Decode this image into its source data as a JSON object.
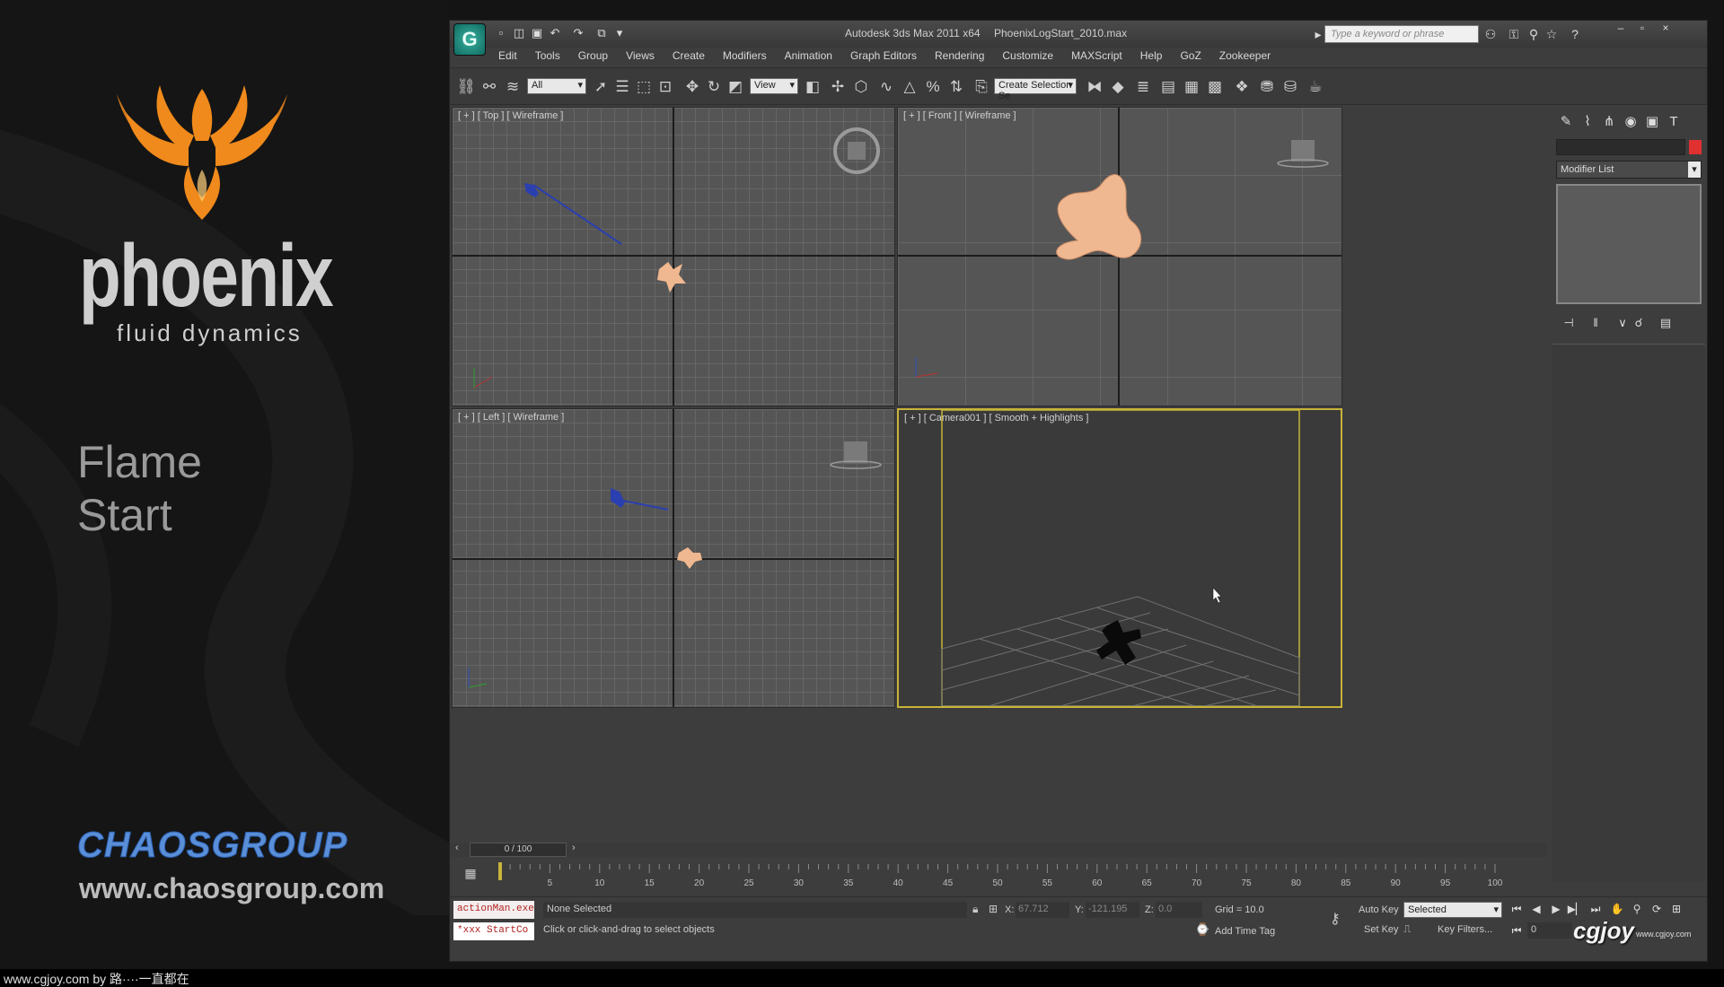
{
  "promo": {
    "brand": "phoenix",
    "tagline": "fluid dynamics",
    "lesson_line1": "Flame",
    "lesson_line2": "Start",
    "company": "CHAOSGROUP",
    "company_url": "www.chaosgroup.com",
    "colors": {
      "logo_orange": "#f08a1c",
      "chaos_blue": "#5a8fd8"
    }
  },
  "window": {
    "app_button": "G",
    "title": "Autodesk 3ds Max 2011 x64",
    "file": "PhoenixLogStart_2010.max",
    "search_placeholder": "Type a keyword or phrase",
    "controls": [
      "–",
      "▫",
      "×"
    ]
  },
  "menu": [
    "Edit",
    "Tools",
    "Group",
    "Views",
    "Create",
    "Modifiers",
    "Animation",
    "Graph Editors",
    "Rendering",
    "Customize",
    "MAXScript",
    "Help",
    "GoZ",
    "Zookeeper"
  ],
  "toolbar": {
    "selection_filter": "All",
    "ref_coord": "View",
    "named_selection": "Create Selection Se"
  },
  "viewports": {
    "top": {
      "label": "[ + ] [ Top ] [ Wireframe ]"
    },
    "front": {
      "label": "[ + ] [ Front ] [ Wireframe ]"
    },
    "left": {
      "label": "[ + ] [ Left ] [ Wireframe ]"
    },
    "camera": {
      "label": "[ + ] [ Camera001 ] [ Smooth + Highlights ]"
    },
    "colors": {
      "object": "#f0b890",
      "emitter": "#2a3fb0",
      "active_border": "#c8b43a"
    }
  },
  "command_panel": {
    "modifier_list": "Modifier List"
  },
  "timeline": {
    "frame_display": "0 / 100",
    "ticks": [
      "5",
      "10",
      "15",
      "20",
      "25",
      "30",
      "35",
      "40",
      "45",
      "50",
      "55",
      "60",
      "65",
      "70",
      "75",
      "80",
      "85",
      "90",
      "95",
      "100"
    ]
  },
  "status": {
    "listener_line1": "actionMan.exe",
    "listener_line2": "*xxx StartCo",
    "selection": "None Selected",
    "prompt": "Click or click-and-drag to select objects",
    "x_label": "X:",
    "x_value": "67.712",
    "y_label": "Y:",
    "y_value": "-121.195",
    "z_label": "Z:",
    "z_value": "0.0",
    "grid": "Grid = 10.0",
    "add_time_tag": "Add Time Tag",
    "auto_key": "Auto Key",
    "set_key": "Set Key",
    "key_mode": "Selected",
    "key_filters": "Key Filters...",
    "frame": "0"
  },
  "credit": "www.cgjoy.com by 路····一直都在",
  "watermark": "cgjoy",
  "watermark_sub": "www.cgjoy.com"
}
